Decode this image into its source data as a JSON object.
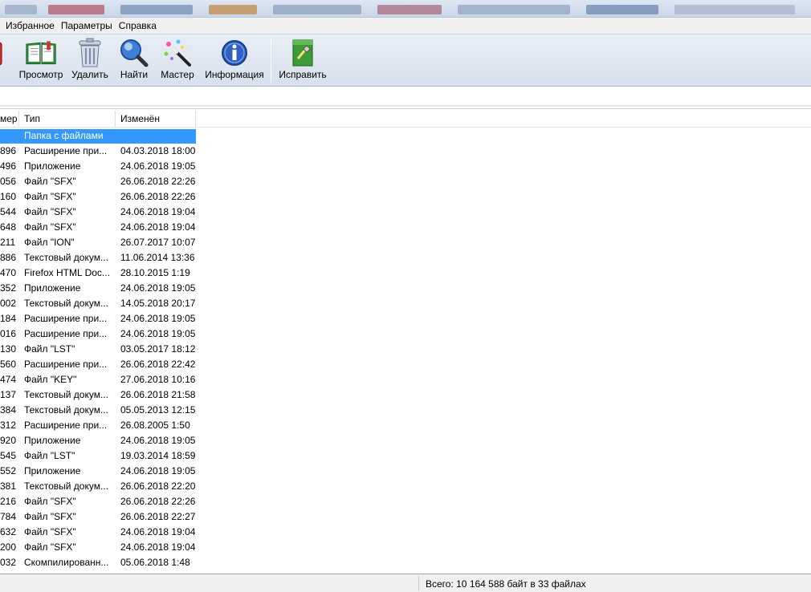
{
  "menu": {
    "items": [
      "Избранное",
      "Параметры",
      "Справка"
    ]
  },
  "toolbar": {
    "buttons": [
      {
        "label": "Просмотр",
        "icon": "book-icon"
      },
      {
        "label": "Удалить",
        "icon": "trash-icon"
      },
      {
        "label": "Найти",
        "icon": "magnifier-icon"
      },
      {
        "label": "Мастер",
        "icon": "wand-icon"
      },
      {
        "label": "Информация",
        "icon": "info-icon"
      },
      {
        "label": "Исправить",
        "icon": "repair-icon"
      }
    ]
  },
  "list": {
    "columns": {
      "size": "мер",
      "type": "Тип",
      "modified": "Изменён"
    },
    "rows": [
      {
        "size": "",
        "type": "Папка с файлами",
        "modified": ""
      },
      {
        "size": "896",
        "type": "Расширение при...",
        "modified": "04.03.2018 18:00"
      },
      {
        "size": "496",
        "type": "Приложение",
        "modified": "24.06.2018 19:05"
      },
      {
        "size": "056",
        "type": "Файл \"SFX\"",
        "modified": "26.06.2018 22:26"
      },
      {
        "size": "160",
        "type": "Файл \"SFX\"",
        "modified": "26.06.2018 22:26"
      },
      {
        "size": "544",
        "type": "Файл \"SFX\"",
        "modified": "24.06.2018 19:04"
      },
      {
        "size": "648",
        "type": "Файл \"SFX\"",
        "modified": "24.06.2018 19:04"
      },
      {
        "size": "211",
        "type": "Файл \"ION\"",
        "modified": "26.07.2017 10:07"
      },
      {
        "size": "886",
        "type": "Текстовый докум...",
        "modified": "11.06.2014 13:36"
      },
      {
        "size": "470",
        "type": "Firefox HTML Doc...",
        "modified": "28.10.2015 1:19"
      },
      {
        "size": "352",
        "type": "Приложение",
        "modified": "24.06.2018 19:05"
      },
      {
        "size": "002",
        "type": "Текстовый докум...",
        "modified": "14.05.2018 20:17"
      },
      {
        "size": "184",
        "type": "Расширение при...",
        "modified": "24.06.2018 19:05"
      },
      {
        "size": "016",
        "type": "Расширение при...",
        "modified": "24.06.2018 19:05"
      },
      {
        "size": "130",
        "type": "Файл \"LST\"",
        "modified": "03.05.2017 18:12"
      },
      {
        "size": "560",
        "type": "Расширение при...",
        "modified": "26.06.2018 22:42"
      },
      {
        "size": "474",
        "type": "Файл \"KEY\"",
        "modified": "27.06.2018 10:16"
      },
      {
        "size": "137",
        "type": "Текстовый докум...",
        "modified": "26.06.2018 21:58"
      },
      {
        "size": "384",
        "type": "Текстовый докум...",
        "modified": "05.05.2013 12:15"
      },
      {
        "size": "312",
        "type": "Расширение при...",
        "modified": "26.08.2005 1:50"
      },
      {
        "size": "920",
        "type": "Приложение",
        "modified": "24.06.2018 19:05"
      },
      {
        "size": "545",
        "type": "Файл \"LST\"",
        "modified": "19.03.2014 18:59"
      },
      {
        "size": "552",
        "type": "Приложение",
        "modified": "24.06.2018 19:05"
      },
      {
        "size": "381",
        "type": "Текстовый докум...",
        "modified": "26.06.2018 22:20"
      },
      {
        "size": "216",
        "type": "Файл \"SFX\"",
        "modified": "26.06.2018 22:26"
      },
      {
        "size": "784",
        "type": "Файл \"SFX\"",
        "modified": "26.06.2018 22:27"
      },
      {
        "size": "632",
        "type": "Файл \"SFX\"",
        "modified": "24.06.2018 19:04"
      },
      {
        "size": "200",
        "type": "Файл \"SFX\"",
        "modified": "24.06.2018 19:04"
      },
      {
        "size": "032",
        "type": "Скомпилированн...",
        "modified": "05.06.2018 1:48"
      }
    ]
  },
  "status": {
    "summary": "Всего: 10 164 588 байт в 33 файлах"
  },
  "colors": {
    "selection": "#3399ff",
    "toolbar_bg": "#dfe6f0"
  }
}
